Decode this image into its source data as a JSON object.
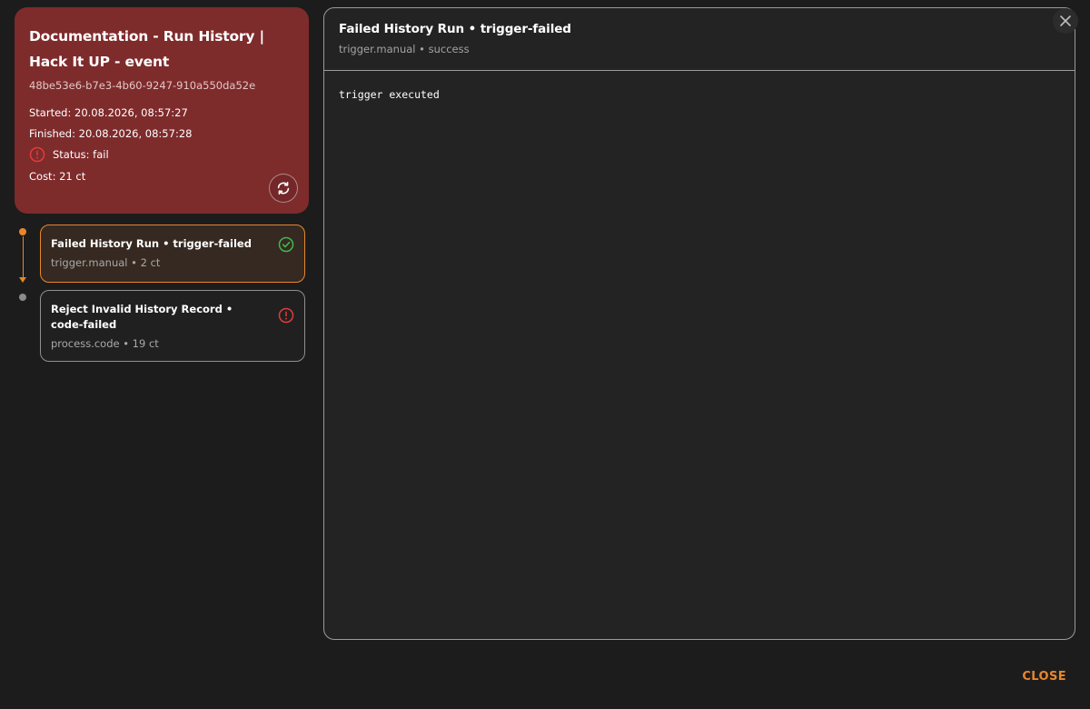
{
  "run": {
    "title": "Documentation - Run History | Hack It UP - event",
    "id": "48be53e6-b7e3-4b60-9247-910a550da52e",
    "started": "Started: 20.08.2026, 08:57:27",
    "finished": "Finished: 20.08.2026, 08:57:28",
    "status": "Status: fail",
    "cost": "Cost: 21 ct",
    "status_color": "#e23b3b",
    "card_color": "#7e2b2c"
  },
  "steps": [
    {
      "title": "Failed History Run • trigger-failed",
      "subtitle": "trigger.manual • 2 ct",
      "state_icon": "check-circle-icon",
      "state_color": "#3fb950",
      "selected": true
    },
    {
      "title": "Reject Invalid History Record • code-failed",
      "subtitle": "process.code • 19 ct",
      "state_icon": "error-circle-icon",
      "state_color": "#e23b3b",
      "selected": false
    }
  ],
  "detail": {
    "title": "Failed History Run • trigger-failed",
    "subtitle": "trigger.manual • success",
    "output": "trigger executed"
  },
  "footer": {
    "close_label": "CLOSE",
    "accent_color": "#e8862e"
  }
}
